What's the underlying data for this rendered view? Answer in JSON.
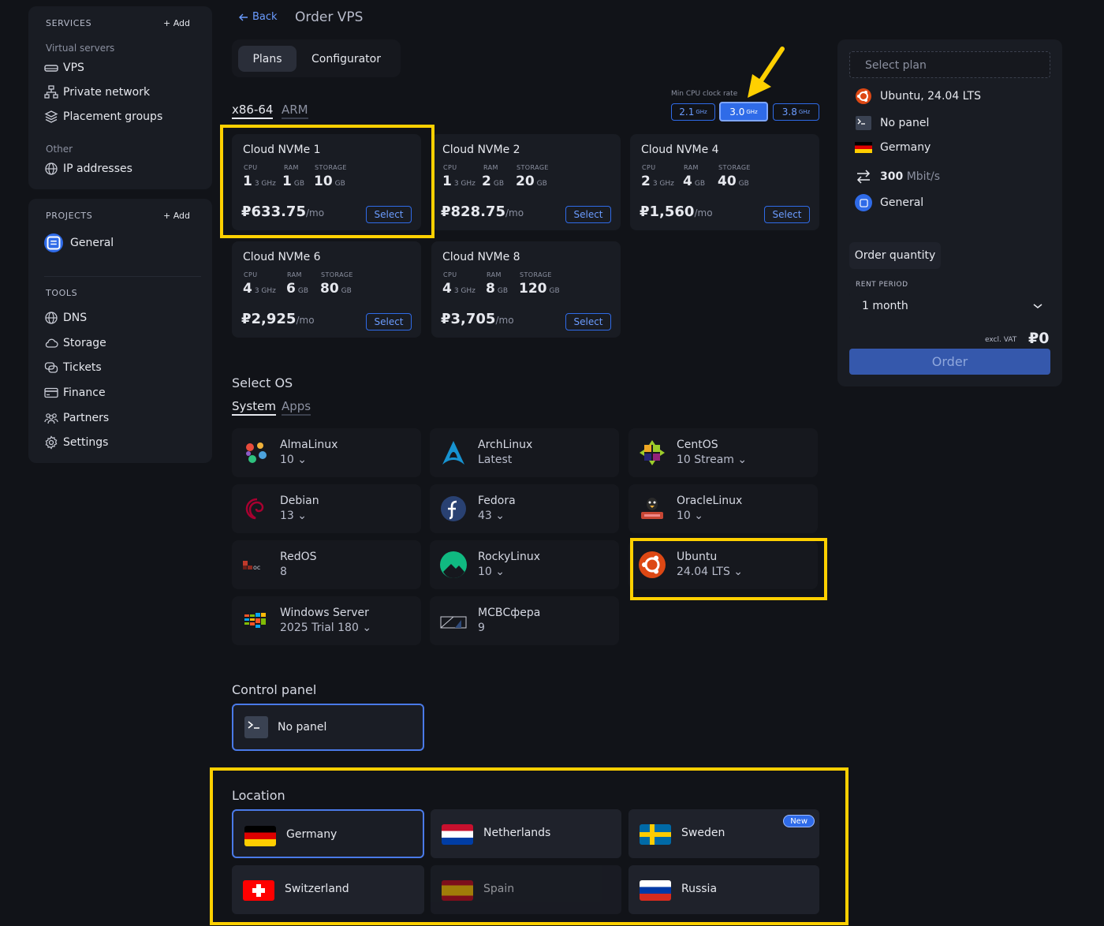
{
  "sidebar": {
    "services_header": "SERVICES",
    "add_label": "+ Add",
    "virtual_servers_label": "Virtual servers",
    "vps": "VPS",
    "private_network": "Private network",
    "placement_groups": "Placement groups",
    "other_label": "Other",
    "ip_addresses": "IP addresses",
    "projects_header": "PROJECTS",
    "project_general": "General",
    "tools_header": "TOOLS",
    "tools": [
      "DNS",
      "Storage",
      "Tickets",
      "Finance",
      "Partners",
      "Settings"
    ]
  },
  "header": {
    "back": "Back",
    "title": "Order VPS"
  },
  "tabs": {
    "plans": "Plans",
    "configurator": "Configurator"
  },
  "arch": {
    "x86": "x86-64",
    "arm": "ARM"
  },
  "clock": {
    "label": "Min CPU clock rate",
    "unit": "GHz",
    "options": [
      "2.1",
      "3.0",
      "3.8"
    ],
    "active": "3.0"
  },
  "spec_labels": {
    "cpu": "CPU",
    "ram": "RAM",
    "storage": "STORAGE",
    "cpu_unit": "3 GHz",
    "gb": "GB",
    "per_mo": "/mo",
    "select": "Select"
  },
  "plans": [
    {
      "name": "Cloud NVMe 1",
      "cpu": "1",
      "ram": "1",
      "storage": "10",
      "price": "₽633.75"
    },
    {
      "name": "Cloud NVMe 2",
      "cpu": "1",
      "ram": "2",
      "storage": "20",
      "price": "₽828.75"
    },
    {
      "name": "Cloud NVMe 4",
      "cpu": "2",
      "ram": "4",
      "storage": "40",
      "price": "₽1,560"
    },
    {
      "name": "Cloud NVMe 6",
      "cpu": "4",
      "ram": "6",
      "storage": "80",
      "price": "₽2,925"
    },
    {
      "name": "Cloud NVMe 8",
      "cpu": "4",
      "ram": "8",
      "storage": "120",
      "price": "₽3,705"
    }
  ],
  "os_section": {
    "title": "Select OS",
    "tab_system": "System",
    "tab_apps": "Apps",
    "items": [
      {
        "name": "AlmaLinux",
        "version": "10",
        "dropdown": true
      },
      {
        "name": "ArchLinux",
        "version": "Latest",
        "dropdown": false
      },
      {
        "name": "CentOS",
        "version": "10 Stream",
        "dropdown": true
      },
      {
        "name": "Debian",
        "version": "13",
        "dropdown": true
      },
      {
        "name": "Fedora",
        "version": "43",
        "dropdown": true
      },
      {
        "name": "OracleLinux",
        "version": "10",
        "dropdown": true
      },
      {
        "name": "RedOS",
        "version": "8",
        "dropdown": false
      },
      {
        "name": "RockyLinux",
        "version": "10",
        "dropdown": true
      },
      {
        "name": "Ubuntu",
        "version": "24.04 LTS",
        "dropdown": true
      },
      {
        "name": "Windows Server",
        "version": "2025 Trial 180",
        "dropdown": true
      },
      {
        "name": "МСВСфера",
        "version": "9",
        "dropdown": false
      }
    ]
  },
  "control_panel": {
    "title": "Control panel",
    "option": "No panel"
  },
  "location": {
    "title": "Location",
    "new_badge": "New",
    "items": [
      "Germany",
      "Netherlands",
      "Sweden",
      "Switzerland",
      "Spain",
      "Russia"
    ]
  },
  "summary": {
    "select_plan": "Select plan",
    "os": "Ubuntu, 24.04 LTS",
    "panel": "No panel",
    "location": "Germany",
    "bandwidth_value": "300",
    "bandwidth_unit": "Mbit/s",
    "project": "General",
    "order_quantity": "Order quantity",
    "rent_period_label": "RENT PERIOD",
    "rent_period": "1 month",
    "excl_vat": "excl. VAT",
    "total": "₽0",
    "order_button": "Order"
  },
  "colors": {
    "accent": "#2f6be8",
    "highlight": "#ffd000",
    "background": "#111318"
  }
}
